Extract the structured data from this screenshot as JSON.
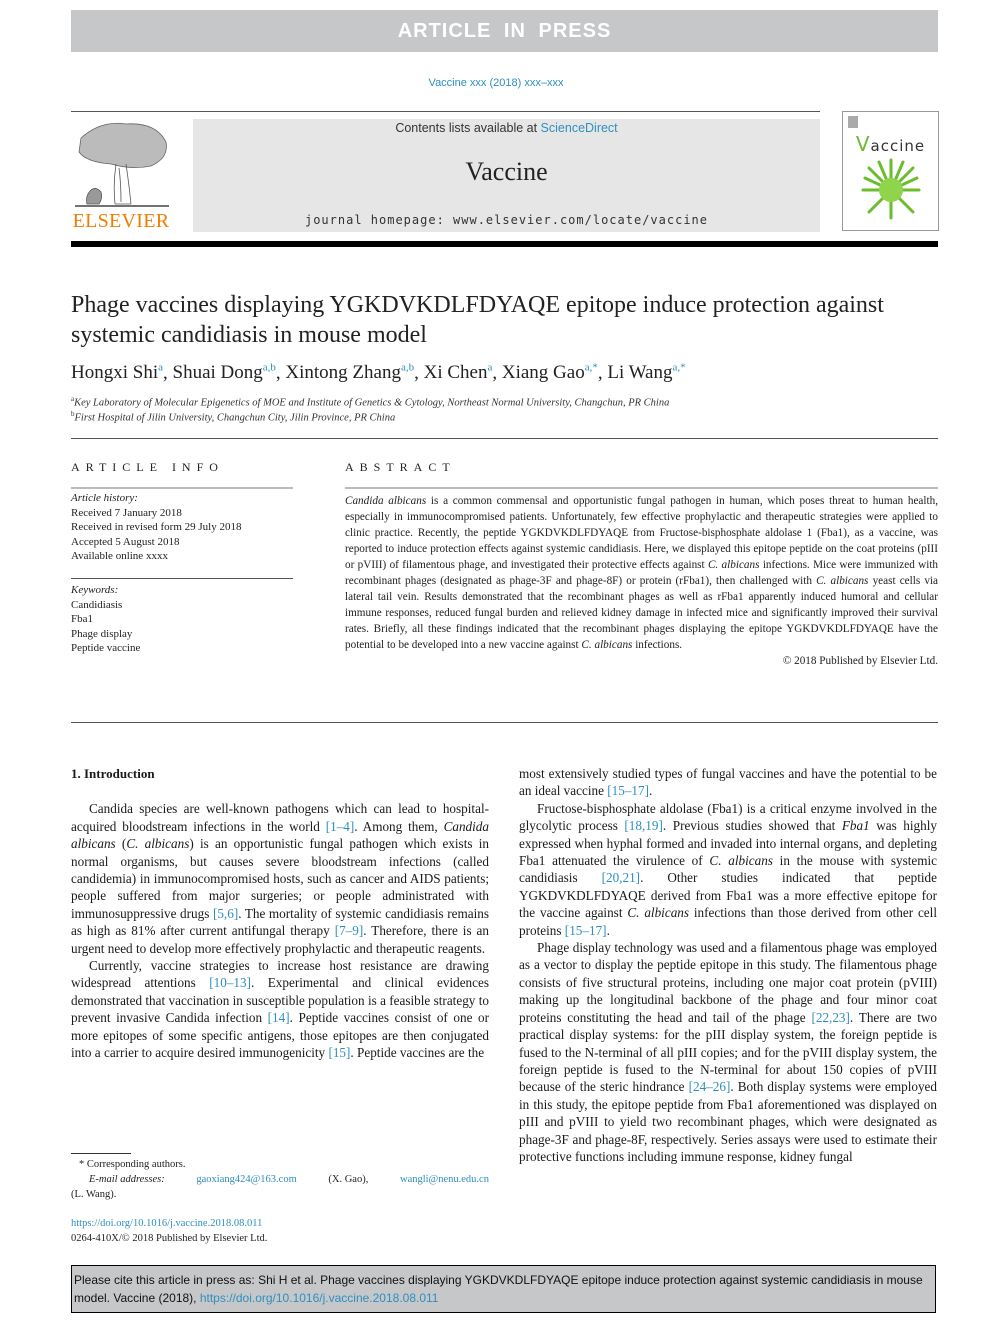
{
  "banner": {
    "text": "ARTICLE IN PRESS"
  },
  "journal_ref": "Vaccine xxx (2018) xxx–xxx",
  "masthead": {
    "publisher_logo_text": "ELSEVIER",
    "contents_prefix": "Contents lists available at ",
    "contents_link": "ScienceDirect",
    "journal_name": "Vaccine",
    "homepage": "journal homepage: www.elsevier.com/locate/vaccine",
    "cover_title_initial": "V",
    "cover_title_rest": "accine"
  },
  "article": {
    "title": "Phage vaccines displaying YGKDVKDLFDYAQE epitope induce protection against systemic candidiasis in mouse model",
    "authors": [
      {
        "name": "Hongxi Shi",
        "sup": "a"
      },
      {
        "name": "Shuai Dong",
        "sup": "a,b"
      },
      {
        "name": "Xintong Zhang",
        "sup": "a,b"
      },
      {
        "name": "Xi Chen",
        "sup": "a"
      },
      {
        "name": "Xiang Gao",
        "sup": "a,*"
      },
      {
        "name": "Li Wang",
        "sup": "a,*"
      }
    ],
    "affiliations": [
      {
        "mark": "a",
        "text": "Key Laboratory of Molecular Epigenetics of MOE and Institute of Genetics & Cytology, Northeast Normal University, Changchun, PR China"
      },
      {
        "mark": "b",
        "text": "First Hospital of Jilin University, Changchun City, Jilin Province, PR China"
      }
    ]
  },
  "article_info": {
    "heading": "ARTICLE INFO",
    "history_label": "Article history:",
    "history": [
      "Received 7 January 2018",
      "Received in revised form 29 July 2018",
      "Accepted 5 August 2018",
      "Available online xxxx"
    ],
    "keywords_label": "Keywords:",
    "keywords": [
      "Candidiasis",
      "Fba1",
      "Phage display",
      "Peptide vaccine"
    ]
  },
  "abstract": {
    "heading": "ABSTRACT",
    "p1_italic": "Candida albicans",
    "p1": " is a common commensal and opportunistic fungal pathogen in human, which poses threat to human health, especially in immunocompromised patients. Unfortunately, few effective prophylactic and therapeutic strategies were applied to clinic practice. Recently, the peptide YGKDVKDLFDYAQE from Fructose-bisphosphate aldolase 1 (Fba1), as a vaccine, was reported to induce protection effects against systemic candidiasis. Here, we displayed this epitope peptide on the coat proteins (pIII or pVIII) of filamentous phage, and investigated their protective effects against ",
    "p2_italic": "C. albicans",
    "p2": " infections. Mice were immunized with recombinant phages (designated as phage-3F and phage-8F) or protein (rFba1), then challenged with ",
    "p3_italic": "C. albicans",
    "p3": " yeast cells via lateral tail vein. Results demonstrated that the recombinant phages as well as rFba1 apparently induced humoral and cellular immune responses, reduced fungal burden and relieved kidney damage in infected mice and significantly improved their survival rates. Briefly, all these findings indicated that the recombinant phages displaying the epitope YGKDVKDLFDYAQE have the potential to be developed into a new vaccine against ",
    "p4_italic": "C. albicans",
    "p4": " infections.",
    "copyright": "© 2018 Published by Elsevier Ltd."
  },
  "intro": {
    "heading": "1. Introduction",
    "left": {
      "p1a": "Candida species are well-known pathogens which can lead to hospital-acquired bloodstream infections in the world ",
      "p1_ref1": "[1–4]",
      "p1b": ". Among them, ",
      "p1_it1": "Candida albicans",
      "p1c": " (",
      "p1_it2": "C. albicans",
      "p1d": ") is an opportunistic fungal pathogen which exists in normal organisms, but causes severe bloodstream infections (called candidemia) in immunocompromised hosts, such as cancer and AIDS patients; people suffered from major surgeries; or people administrated with immunosuppressive drugs ",
      "p1_ref2": "[5,6]",
      "p1e": ". The mortality of systemic candidiasis remains as high as 81% after current antifungal therapy ",
      "p1_ref3": "[7–9]",
      "p1f": ". Therefore, there is an urgent need to develop more effectively prophylactic and therapeutic reagents.",
      "p2a": "Currently, vaccine strategies to increase host resistance are drawing widespread attentions ",
      "p2_ref1": "[10–13]",
      "p2b": ". Experimental and clinical evidences demonstrated that vaccination in susceptible population is a feasible strategy to prevent invasive Candida infection ",
      "p2_ref2": "[14]",
      "p2c": ". Peptide vaccines consist of one or more epitopes of some specific antigens, those epitopes are then conjugated into a carrier to acquire desired immunogenicity ",
      "p2_ref3": "[15]",
      "p2d": ". Peptide vaccines are the"
    },
    "right": {
      "p0a": "most extensively studied types of fungal vaccines and have the potential to be an ideal vaccine ",
      "p0_ref": "[15–17]",
      "p0b": ".",
      "p1a": "Fructose-bisphosphate aldolase (Fba1) is a critical enzyme involved in the glycolytic process ",
      "p1_ref1": "[18,19]",
      "p1b": ". Previous studies showed that ",
      "p1_it1": "Fba1",
      "p1c": " was highly expressed when hyphal formed and invaded into internal organs, and depleting Fba1 attenuated the virulence of ",
      "p1_it2": "C. albicans",
      "p1d": " in the mouse with systemic candidiasis ",
      "p1_ref2": "[20,21]",
      "p1e": ". Other studies indicated that peptide YGKDVKDLFDYAQE derived from Fba1 was a more effective epitope for the vaccine against ",
      "p1_it3": "C. albicans",
      "p1f": " infections than those derived from other cell proteins ",
      "p1_ref3": "[15–17]",
      "p1g": ".",
      "p2a": "Phage display technology was used and a filamentous phage was employed as a vector to display the peptide epitope in this study. The filamentous phage consists of five structural proteins, including one major coat protein (pVIII) making up the longitudinal backbone of the phage and four minor coat proteins constituting the head and tail of the phage ",
      "p2_ref1": "[22,23]",
      "p2b": ". There are two practical display systems: for the pIII display system, the foreign peptide is fused to the N-terminal of all pIII copies; and for the pVIII display system, the foreign peptide is fused to the N-terminal for about 150 copies of pVIII because of the steric hindrance ",
      "p2_ref2": "[24–26]",
      "p2c": ". Both display systems were employed in this study, the epitope peptide from Fba1 aforementioned was displayed on pIII and pVIII to yield two recombinant phages, which were designated as phage-3F and phage-8F, respectively. Series assays were used to estimate their protective functions including immune response, kidney fungal"
    }
  },
  "footnotes": {
    "corresponding": "* Corresponding authors.",
    "email_label": "E-mail addresses:",
    "email1": "gaoxiang424@163.com",
    "email1_who": " (X. Gao), ",
    "email2": "wangli@nenu.edu.cn",
    "email2_who": "(L. Wang).",
    "doi": "https://doi.org/10.1016/j.vaccine.2018.08.011",
    "issn": "0264-410X/© 2018 Published by Elsevier Ltd."
  },
  "cite_box": {
    "text": "Please cite this article in press as: Shi H et al. Phage vaccines displaying YGKDVKDLFDYAQE epitope induce protection against systemic candidiasis in mouse model. Vaccine (2018), ",
    "link": "https://doi.org/10.1016/j.vaccine.2018.08.011"
  },
  "colors": {
    "link": "#2e8fbf",
    "banner": "#c6c7c9",
    "elsevier_orange": "#f07c00",
    "cover_green": "#6abd2d"
  }
}
